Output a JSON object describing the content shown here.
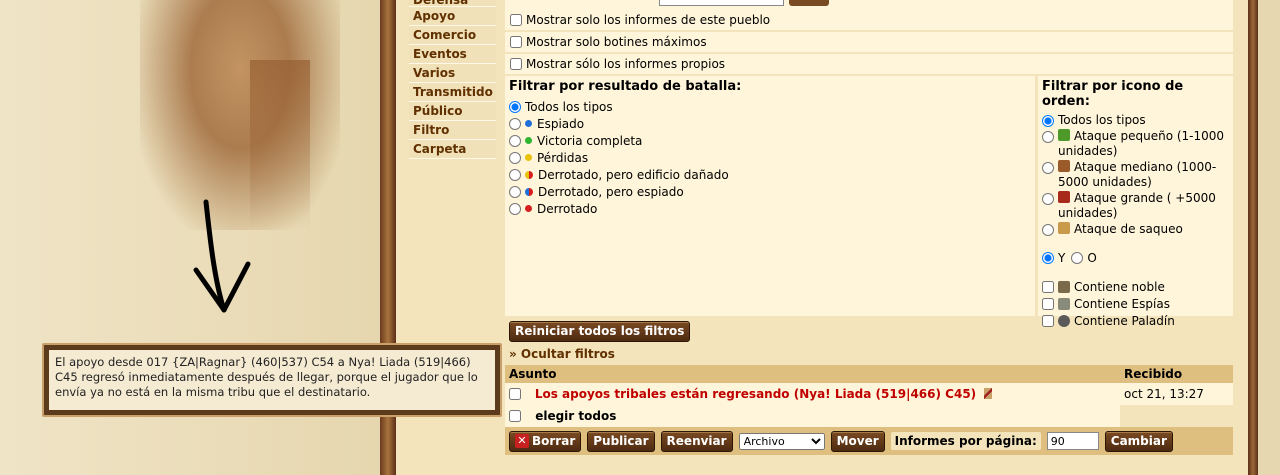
{
  "menu": {
    "items": [
      "Defensa",
      "Apoyo",
      "Comercio",
      "Eventos",
      "Varios",
      "Transmitido",
      "Público",
      "Filtro",
      "Carpeta"
    ]
  },
  "options": {
    "village_only": "Mostrar solo los informes de este pueblo",
    "max_loot": "Mostrar solo botines máximos",
    "own_only": "Mostrar sólo los informes propios"
  },
  "battle_filter": {
    "title": "Filtrar por resultado de batalla:",
    "options": [
      {
        "label": "Todos los tipos",
        "dot": "",
        "checked": true
      },
      {
        "label": "Espiado",
        "dot": "#1e6fd9",
        "checked": false
      },
      {
        "label": "Victoria completa",
        "dot": "#2fb52f",
        "checked": false
      },
      {
        "label": "Pérdidas",
        "dot": "#e8c20a",
        "checked": false
      },
      {
        "label": "Derrotado, pero edificio dañado",
        "dot": "half-yellow-red",
        "checked": false
      },
      {
        "label": "Derrotado, pero espiado",
        "dot": "half-blue-red",
        "checked": false
      },
      {
        "label": "Derrotado",
        "dot": "#d62020",
        "checked": false
      }
    ]
  },
  "order_filter": {
    "title": "Filtrar por icono de orden:",
    "options": [
      {
        "label": "Todos los tipos",
        "icon": ""
      },
      {
        "label": "Ataque pequeño (1-1000 unidades)",
        "icon": "small-attack-icon"
      },
      {
        "label": "Ataque mediano (1000-5000 unidades)",
        "icon": "medium-attack-icon"
      },
      {
        "label": "Ataque grande ( +5000 unidades)",
        "icon": "large-attack-icon"
      },
      {
        "label": "Ataque de saqueo",
        "icon": "plunder-icon"
      }
    ],
    "and_label": "Y",
    "or_label": "O",
    "contains": [
      {
        "label": "Contiene noble",
        "icon": "noble-icon"
      },
      {
        "label": "Contiene Espías",
        "icon": "spy-icon"
      },
      {
        "label": "Contiene Paladín",
        "icon": "paladin-icon"
      }
    ]
  },
  "reset_button": "Reiniciar todos los filtros",
  "hide_filters": "» Ocultar filtros",
  "table": {
    "col_subject": "Asunto",
    "col_received": "Recibido",
    "rows": [
      {
        "subject": "Los apoyos tribales están regresando (Nya! Liada (519|466) C45)",
        "received": "oct 21, 13:27"
      }
    ],
    "select_all": "elegir todos"
  },
  "footer": {
    "delete": "Borrar",
    "publish": "Publicar",
    "forward": "Reenviar",
    "folder_select": "Archivo",
    "move": "Mover",
    "per_page_label": "Informes por página:",
    "per_page_value": "90",
    "change": "Cambiar"
  },
  "tooltip": {
    "text": "El apoyo desde 017 {ZA|Ragnar} (460|537) C54 a Nya! Liada (519|466) C45 regresó inmediatamente después de llegar, porque el jugador que lo envía ya no está en la misma tribu que el destinatario."
  },
  "colors": {
    "menu_text": "#603000",
    "row_bg": "#fff5da",
    "header_bg": "#dfbf7f",
    "subject_red": "#c00000"
  }
}
